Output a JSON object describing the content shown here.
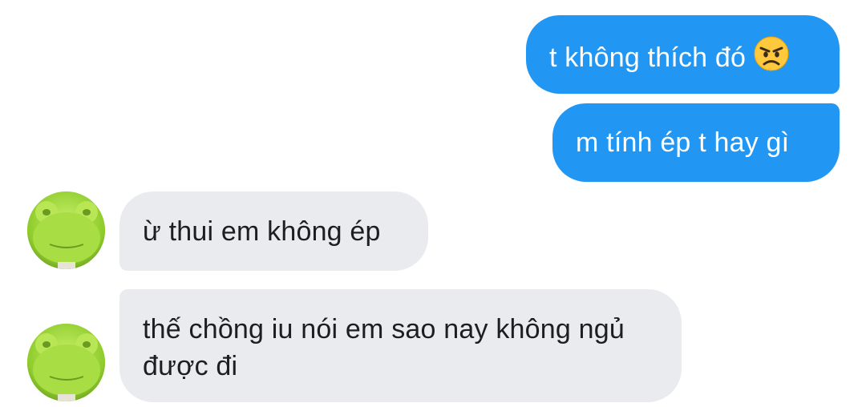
{
  "messages": [
    {
      "direction": "out",
      "text": "t không thích đó",
      "emoji": "angry-face"
    },
    {
      "direction": "out",
      "text": "m tính ép t hay gì"
    },
    {
      "direction": "in",
      "text": "ừ thui em không ép"
    },
    {
      "direction": "in",
      "text": "thế chồng iu nói em sao nay không ngủ được đi"
    }
  ],
  "colors": {
    "outgoing_bubble": "#2196f3",
    "incoming_bubble": "#e9ebef",
    "avatar_green": "#a7d83b"
  }
}
